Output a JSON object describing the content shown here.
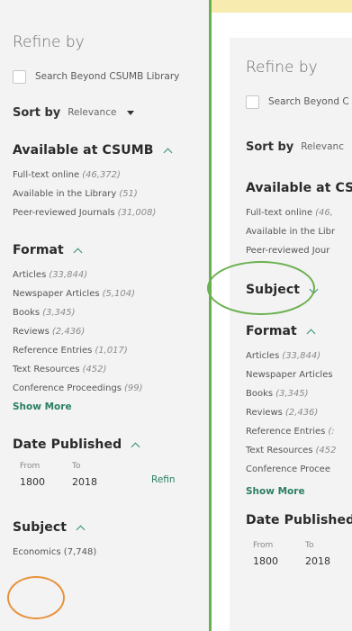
{
  "left": {
    "refine_title": "Refine by",
    "search_beyond_label": "Search Beyond CSUMB Library",
    "sort_by_label": "Sort by",
    "sort_value": "Relevance",
    "available_title": "Available at CSUMB",
    "available_items": [
      {
        "label": "Full-text online",
        "count": "(46,372)"
      },
      {
        "label": "Available in the Library",
        "count": "(51)"
      },
      {
        "label": "Peer-reviewed Journals",
        "count": "(31,008)"
      }
    ],
    "format_title": "Format",
    "format_items": [
      {
        "label": "Articles",
        "count": "(33,844)"
      },
      {
        "label": "Newspaper Articles",
        "count": "(5,104)"
      },
      {
        "label": "Books",
        "count": "(3,345)"
      },
      {
        "label": "Reviews",
        "count": "(2,436)"
      },
      {
        "label": "Reference Entries",
        "count": "(1,017)"
      },
      {
        "label": "Text Resources",
        "count": "(452)"
      },
      {
        "label": "Conference Proceedings",
        "count": "(99)"
      }
    ],
    "show_more": "Show More",
    "date_title": "Date Published",
    "from_label": "From",
    "to_label": "To",
    "from_value": "1800",
    "to_value": "2018",
    "refine_link": "Refin",
    "subject_title": "Subject",
    "subject_first_item": "Economics (7,748)"
  },
  "right": {
    "refine_title": "Refine by",
    "search_beyond_label": "Search Beyond C",
    "sort_by_label": "Sort by",
    "sort_value": "Relevanc",
    "available_title": "Available at CSU",
    "available_items": [
      {
        "label": "Full-text online",
        "count": "(46,"
      },
      {
        "label": "Available in the Libr",
        "count": ""
      },
      {
        "label": "Peer-reviewed Jour",
        "count": ""
      }
    ],
    "subject_title": "Subject",
    "format_title": "Format",
    "format_items": [
      {
        "label": "Articles",
        "count": "(33,844)"
      },
      {
        "label": "Newspaper Articles",
        "count": ""
      },
      {
        "label": "Books",
        "count": "(3,345)"
      },
      {
        "label": "Reviews",
        "count": "(2,436)"
      },
      {
        "label": "Reference Entries",
        "count": "(:"
      },
      {
        "label": "Text Resources",
        "count": "(452"
      },
      {
        "label": "Conference Procee",
        "count": ""
      }
    ],
    "show_more": "Show More",
    "date_title": "Date Published",
    "from_label": "From",
    "to_label": "To",
    "from_value": "1800",
    "to_value": "2018"
  },
  "colors": {
    "accent_green": "#2a7f62",
    "annotation_orange": "#e8923a",
    "annotation_green": "#6bb04f",
    "highlight_yellow": "#f7ebb0"
  }
}
